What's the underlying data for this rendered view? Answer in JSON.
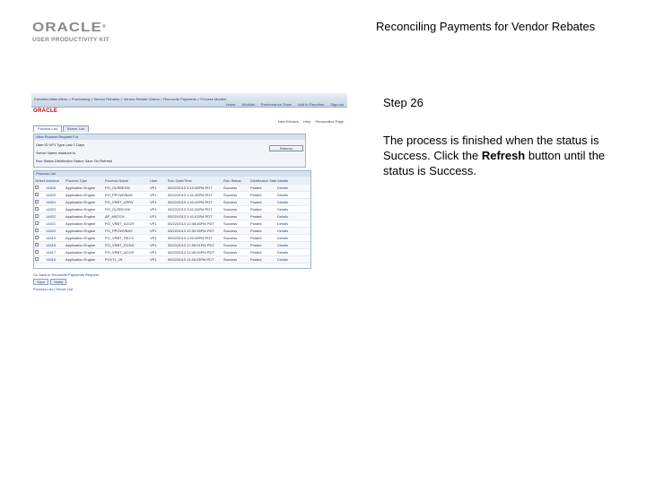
{
  "header": {
    "logo_word": "ORACLE",
    "logo_sub": "USER PRODUCTIVITY KIT",
    "title": "Reconciling Payments for Vendor Rebates"
  },
  "step": {
    "label": "Step 26",
    "text_before": "The process is finished when the status is Success. Click the ",
    "text_bold": "Refresh",
    "text_after": " button until the status is Success."
  },
  "screenshot": {
    "breadcrumbs": "Favorites   Main Menu  >  Purchasing  >  Vendor Rebates  >  Vendor Rebate Claims  >  Reconcile Payments  >  Process Monitor",
    "brand": "ORACLE",
    "top_links": [
      "Home",
      "Worklist",
      "Performance Trace",
      "Add to Favorites",
      "Sign out"
    ],
    "tabs": [
      "Process List",
      "Server List"
    ],
    "right_links": [
      "New Window",
      "Help",
      "Personalize Page"
    ],
    "criteria_title": "View Process Request For",
    "criteria_row1": "User ID  VP1        Type        Last        1   Days",
    "criteria_row2": "Server        Name        Instance        to",
    "criteria_row3": "Run Status        Distribution Status        Save On Refresh",
    "refresh_label": "Refresh",
    "grid_title": "Process List",
    "columns": [
      "Select",
      "Instance",
      "Seq.",
      "Process Type",
      "Process Name",
      "User",
      "Run Date/Time",
      "Run Status",
      "Distribution Status",
      "Details"
    ],
    "rows": [
      [
        "",
        "14826",
        "Application Engine",
        "PO_OLRBEVW",
        "VP1",
        "05/22/2013 3:10:45PM PDT",
        "Success",
        "Posted",
        "Details"
      ],
      [
        "",
        "14825",
        "Application Engine",
        "PO_PPCWVBAS",
        "VP1",
        "05/22/2013 1:41:49PM PDT",
        "Success",
        "Posted",
        "Details"
      ],
      [
        "",
        "14824",
        "Application Engine",
        "PO_VRBT_APRV",
        "VP1",
        "05/22/2013 1:41:41PM PDT",
        "Success",
        "Posted",
        "Details"
      ],
      [
        "",
        "14823",
        "Application Engine",
        "PO_OLRBCVW",
        "VP1",
        "05/22/2013 1:41:34PM PDT",
        "Success",
        "Posted",
        "Details"
      ],
      [
        "",
        "14822",
        "Application Engine",
        "AP_MATCH",
        "VP1",
        "05/22/2013 1:41:01PM PDT",
        "Success",
        "Posted",
        "Details"
      ],
      [
        "",
        "14821",
        "Application Engine",
        "PO_VRBT_ACCR",
        "VP1",
        "05/22/2013 12:48:46PM PDT",
        "Success",
        "Posted",
        "Details"
      ],
      [
        "",
        "14820",
        "Application Engine",
        "PO_PPCWVBAS",
        "VP1",
        "05/22/2013 12:33:35PM PDT",
        "Success",
        "Posted",
        "Details"
      ],
      [
        "",
        "14819",
        "Application Engine",
        "PO_VRBT_RECV",
        "VP1",
        "05/22/2013 1:00:35PM PDT",
        "Success",
        "Posted",
        "Details"
      ],
      [
        "",
        "14818",
        "Application Engine",
        "PO_VRBT_RCND",
        "VP1",
        "05/22/2013 12:59:51PM PDT",
        "Success",
        "Posted",
        "Details"
      ],
      [
        "",
        "14817",
        "Application Engine",
        "PO_VRBT_ACCR",
        "VP1",
        "05/22/2013 12:49:04PM PDT",
        "Success",
        "Posted",
        "Details"
      ],
      [
        "",
        "14816",
        "Application Engine",
        "POVTL_IN",
        "VP1",
        "05/22/2013 11:45:23PM PDT",
        "Success",
        "Posted",
        "Details"
      ]
    ],
    "footer_text": "Go back to Reconcile Payments Request",
    "buttons": [
      "Save",
      "Notify"
    ],
    "footer_link": "Process List | Server List"
  }
}
